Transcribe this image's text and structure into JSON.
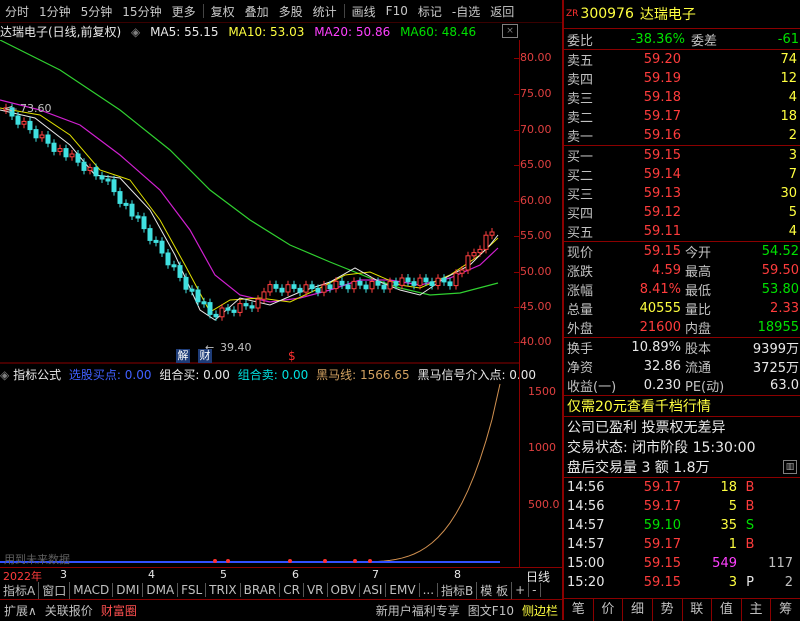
{
  "toolbar": {
    "items": [
      "分时",
      "1分钟",
      "5分钟",
      "15分钟",
      "更多",
      "复权",
      "叠加",
      "多股",
      "统计",
      "画线",
      "F10",
      "标记",
      "-自选",
      "返回"
    ]
  },
  "chart_header": {
    "name": "达瑞电子(日线,前复权)",
    "ma5": "MA5: 55.15",
    "ma10": "MA10: 53.03",
    "ma20": "MA20: 50.86",
    "ma60": "MA60: 48.46"
  },
  "price_axis": [
    "80.00",
    "75.00",
    "70.00",
    "65.00",
    "60.00",
    "55.00",
    "50.00",
    "45.00",
    "40.00"
  ],
  "annotations": {
    "high_label": "73.60",
    "low_label": "39.40",
    "jie": "解",
    "cai": "财",
    "dollar": "$"
  },
  "indicator_header": {
    "name": "指标公式",
    "buy_point": "选股买点: 0.00",
    "combo_buy": "组合买: 0.00",
    "combo_sell": "组合卖: 0.00",
    "horse_line": "黑马线: 1566.65",
    "horse_signal": "黑马信号介入点: 0.00"
  },
  "indicator_axis": [
    "1500",
    "1000",
    "500.0"
  ],
  "indicator_note": "用到未来数据",
  "time_axis": {
    "year": "2022年",
    "months": [
      "3",
      "4",
      "5",
      "6",
      "7",
      "8"
    ],
    "period": "日线"
  },
  "tabs": [
    "指标A",
    "窗口",
    "MACD",
    "DMI",
    "DMA",
    "FSL",
    "TRIX",
    "BRAR",
    "CR",
    "VR",
    "OBV",
    "ASI",
    "EMV",
    "...",
    "指标B",
    "模 板",
    "+",
    "-"
  ],
  "bottom_bar": [
    "扩展∧",
    "关联报价",
    "财富圈",
    "新用户福利专享",
    "图文F10",
    "侧边栏"
  ],
  "stock": {
    "code": "300976",
    "name": "达瑞电子",
    "badge": "ZR"
  },
  "weibi": {
    "label": "委比",
    "value": "-38.36%",
    "diff_label": "委差",
    "diff": "-61"
  },
  "asks": [
    {
      "label": "卖五",
      "price": "59.20",
      "vol": "74"
    },
    {
      "label": "卖四",
      "price": "59.19",
      "vol": "12"
    },
    {
      "label": "卖三",
      "price": "59.18",
      "vol": "4"
    },
    {
      "label": "卖二",
      "price": "59.17",
      "vol": "18"
    },
    {
      "label": "卖一",
      "price": "59.16",
      "vol": "2"
    }
  ],
  "bids": [
    {
      "label": "买一",
      "price": "59.15",
      "vol": "3"
    },
    {
      "label": "买二",
      "price": "59.14",
      "vol": "7"
    },
    {
      "label": "买三",
      "price": "59.13",
      "vol": "30"
    },
    {
      "label": "买四",
      "price": "59.12",
      "vol": "5"
    },
    {
      "label": "买五",
      "price": "59.11",
      "vol": "4"
    }
  ],
  "quote": [
    {
      "l1": "现价",
      "v1": "59.15",
      "l2": "今开",
      "v2": "54.52"
    },
    {
      "l1": "涨跌",
      "v1": "4.59",
      "l2": "最高",
      "v2": "59.50"
    },
    {
      "l1": "涨幅",
      "v1": "8.41%",
      "l2": "最低",
      "v2": "53.80"
    },
    {
      "l1": "总量",
      "v1": "40555",
      "l2": "量比",
      "v2": "2.33"
    },
    {
      "l1": "外盘",
      "v1": "21600",
      "l2": "内盘",
      "v2": "18955"
    }
  ],
  "stats": [
    {
      "l1": "换手",
      "v1": "10.89%",
      "l2": "股本",
      "v2": "9399万"
    },
    {
      "l1": "净资",
      "v1": "32.86",
      "l2": "流通",
      "v2": "3725万"
    },
    {
      "l1": "收益(一)",
      "v1": "0.230",
      "l2": "PE(动)",
      "v2": "63.0"
    }
  ],
  "promo": "仅需20元查看千档行情",
  "info1": "公司已盈利 投票权无差异",
  "status": "交易状态: 闭市阶段 15:30:00",
  "after_hours": "盘后交易量 3 额 1.8万",
  "ticks": [
    {
      "t": "14:56",
      "p": "59.17",
      "v": "18",
      "s": "B"
    },
    {
      "t": "14:56",
      "p": "59.17",
      "v": "5",
      "s": "B"
    },
    {
      "t": "14:57",
      "p": "59.10",
      "v": "35",
      "s": "S"
    },
    {
      "t": "14:57",
      "p": "59.17",
      "v": "1",
      "s": "B"
    },
    {
      "t": "15:00",
      "p": "59.15",
      "v": "549",
      "s": "",
      "n": "117"
    },
    {
      "t": "15:20",
      "p": "59.15",
      "v": "3",
      "s": "P",
      "n": "2"
    }
  ],
  "right_tabs": [
    "笔",
    "价",
    "细",
    "势",
    "联",
    "值",
    "主",
    "筹"
  ]
}
